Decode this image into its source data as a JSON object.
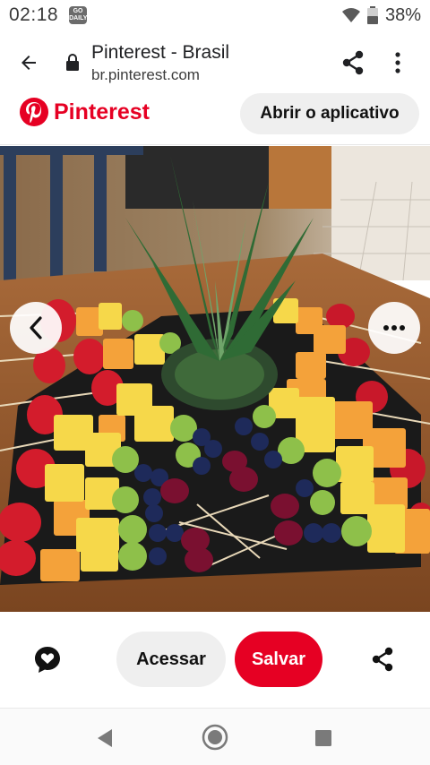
{
  "status_bar": {
    "time": "02:18",
    "app_badge": "GO DAILY",
    "battery": "38%"
  },
  "browser": {
    "title": "Pinterest - Brasil",
    "url": "br.pinterest.com"
  },
  "pinterest_header": {
    "brand": "Pinterest",
    "open_app_label": "Abrir o aplicativo"
  },
  "pin_image": {
    "subject": "fruit skewer platter with pineapple top"
  },
  "actions": {
    "access_label": "Acessar",
    "save_label": "Salvar"
  },
  "icons": {
    "back": "arrow-left-icon",
    "lock": "lock-icon",
    "share": "share-icon",
    "more": "more-vert-icon",
    "comment": "comment-heart-icon",
    "nav_back": "triangle-back-icon",
    "nav_home": "circle-home-icon",
    "nav_recent": "square-recents-icon"
  },
  "colors": {
    "brand_red": "#e60023",
    "button_gray": "#efefef"
  }
}
